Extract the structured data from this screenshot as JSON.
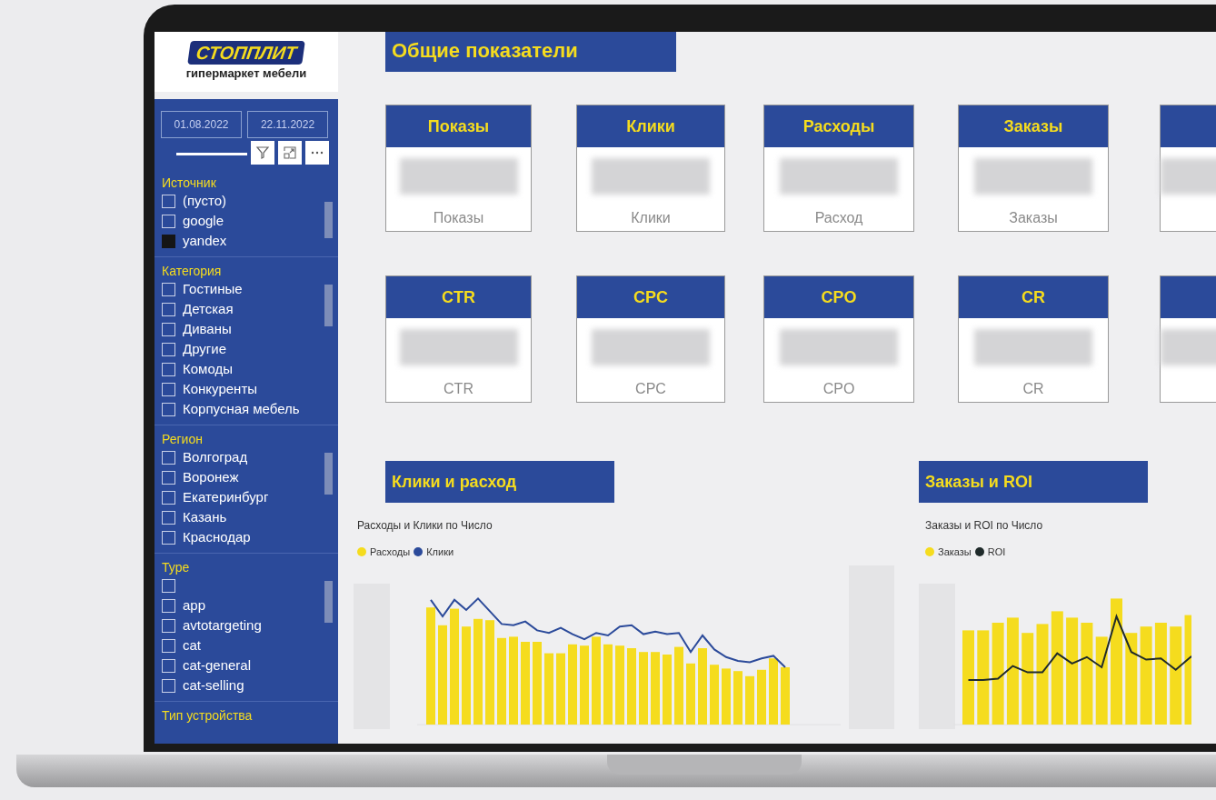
{
  "sidebar": {
    "logo": {
      "brand": "СТОППЛИТ",
      "tagline": "гипермаркет мебели"
    },
    "date_range": {
      "start": "01.08.2022",
      "end": "22.11.2022"
    },
    "filters": [
      {
        "title": "Источник",
        "items": [
          {
            "label": "(пусто)",
            "checked": false
          },
          {
            "label": "google",
            "checked": false
          },
          {
            "label": "yandex",
            "checked": true
          }
        ]
      },
      {
        "title": "Категория",
        "items": [
          {
            "label": "Гостиные",
            "checked": false
          },
          {
            "label": "Детская",
            "checked": false
          },
          {
            "label": "Диваны",
            "checked": false
          },
          {
            "label": "Другие",
            "checked": false
          },
          {
            "label": "Комоды",
            "checked": false
          },
          {
            "label": "Конкуренты",
            "checked": false
          },
          {
            "label": "Корпусная мебель",
            "checked": false
          }
        ]
      },
      {
        "title": "Регион",
        "items": [
          {
            "label": "Волгоград",
            "checked": false
          },
          {
            "label": "Воронеж",
            "checked": false
          },
          {
            "label": "Екатеринбург",
            "checked": false
          },
          {
            "label": "Казань",
            "checked": false
          },
          {
            "label": "Краснодар",
            "checked": false
          }
        ]
      },
      {
        "title": "Type",
        "items": [
          {
            "checked": false
          },
          {
            "label": "app",
            "checked": false
          },
          {
            "label": "avtotargeting",
            "checked": false
          },
          {
            "label": "cat",
            "checked": false
          },
          {
            "label": "cat-general",
            "checked": false
          },
          {
            "label": "cat-selling",
            "checked": false
          }
        ]
      },
      {
        "title": "Тип устройства"
      }
    ]
  },
  "page_title": "Общие показатели",
  "kpi_rows": [
    [
      {
        "title": "Показы",
        "caption": "Показы"
      },
      {
        "title": "Клики",
        "caption": "Клики"
      },
      {
        "title": "Расходы",
        "caption": "Расход"
      },
      {
        "title": "Заказы",
        "caption": "Заказы"
      },
      {}
    ],
    [
      {
        "title": "CTR",
        "caption": "CTR"
      },
      {
        "title": "CPC",
        "caption": "CPC"
      },
      {
        "title": "CPO",
        "caption": "CPO"
      },
      {
        "title": "CR",
        "caption": "CR"
      },
      {}
    ]
  ],
  "charts": [
    {
      "heading": "Клики и расход",
      "subtitle": "Расходы и Клики по Число",
      "legend": [
        {
          "label": "Расходы",
          "color": "#f5dc1e"
        },
        {
          "label": "Клики",
          "color": "#2b4a9a"
        }
      ]
    },
    {
      "heading": "Заказы и ROI",
      "subtitle": "Заказы и ROI по Число",
      "legend": [
        {
          "label": "Заказы",
          "color": "#f5dc1e"
        },
        {
          "label": "ROI",
          "color": "#1f2a2a"
        }
      ]
    }
  ]
}
